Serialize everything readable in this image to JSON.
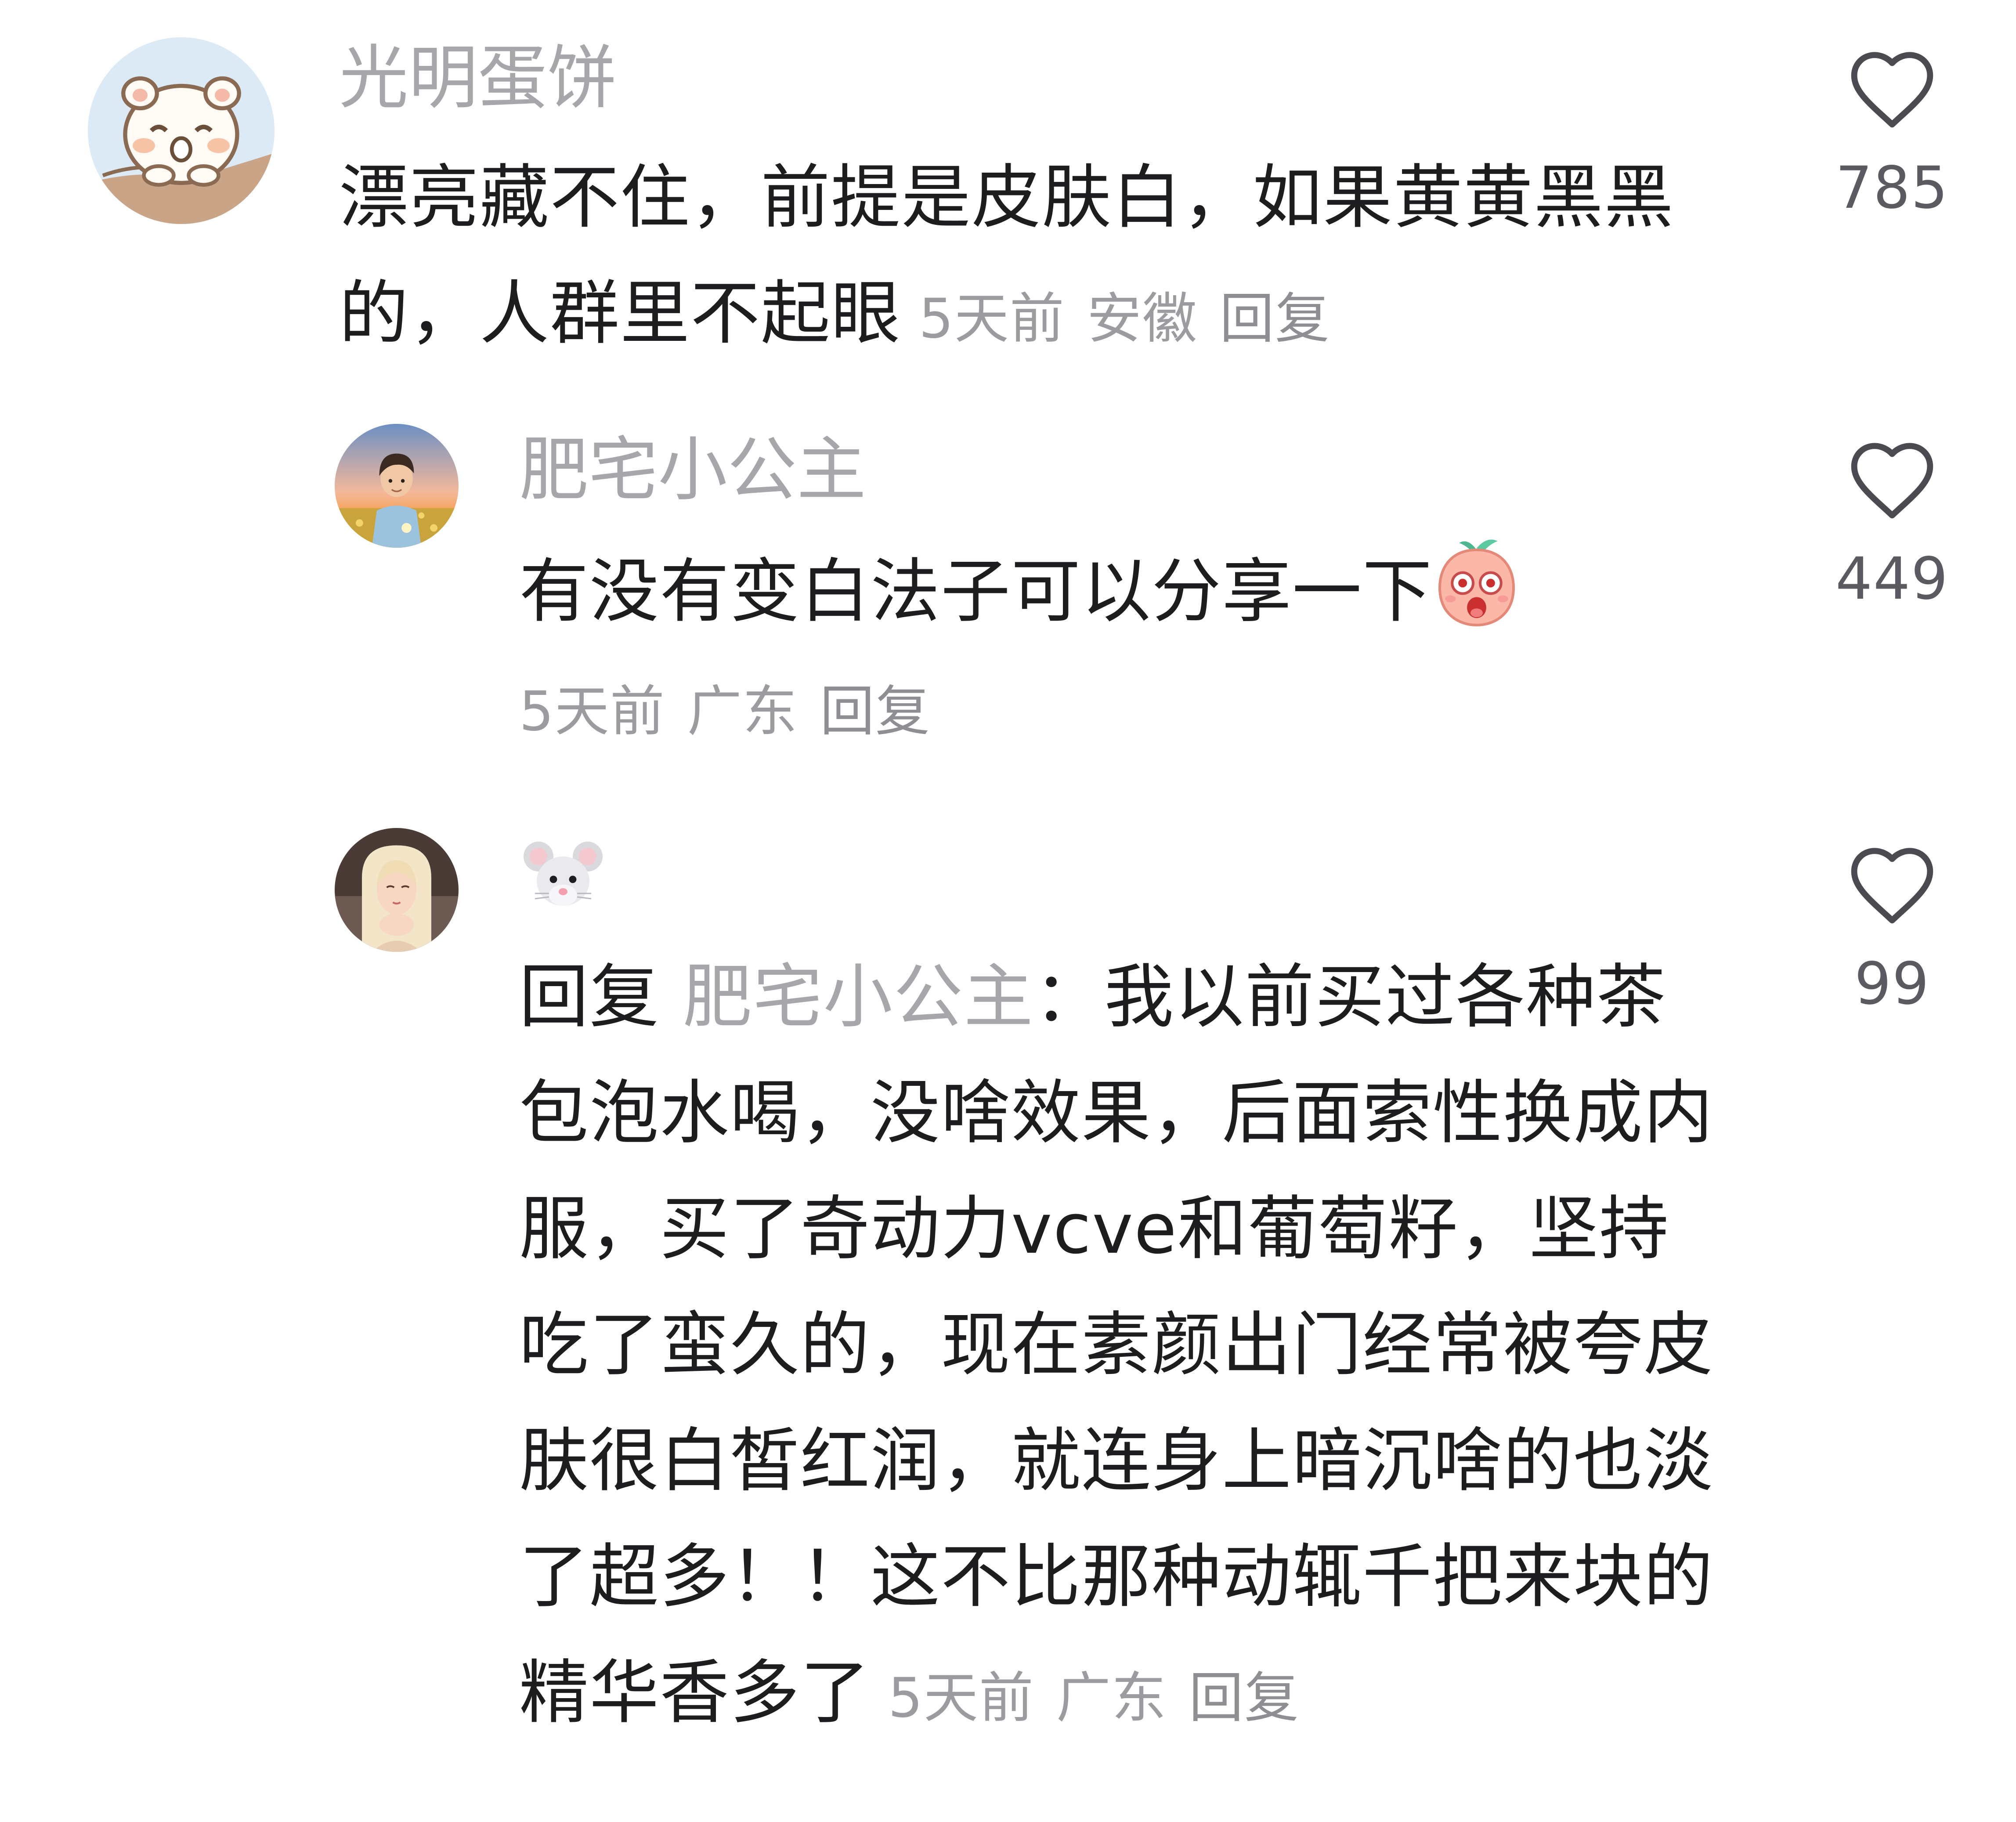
{
  "comments": [
    {
      "username": "光明蛋饼",
      "text": "漂亮藏不住，前提是皮肤白，如果黄黄黑黑的，人群里不起眼",
      "time": "5天前",
      "location": "安徽",
      "reply": "回复",
      "likes": "785",
      "avatar_icon": "cartoon-hamster-avatar"
    },
    {
      "username": "肥宅小公主",
      "text": "有没有变白法子可以分享一下",
      "emoji": "shocked-peach-emoji",
      "time": "5天前",
      "location": "广东",
      "reply": "回复",
      "likes": "449",
      "avatar_icon": "boy-sunset-avatar"
    },
    {
      "username_emoji": "mouse-face-emoji",
      "reply_prefix": "回复",
      "reply_to": "肥宅小公主",
      "colon": "：",
      "text": "我以前买过各种茶包泡水喝，没啥效果，后面索性换成内服，买了奇动力vcve和葡萄籽，坚持吃了蛮久的，现在素颜出门经常被夸皮肤很白皙红润，就连身上暗沉啥的也淡了超多！！这不比那种动辄千把来块的精华香多了",
      "time": "5天前",
      "location": "广东",
      "reply": "回复",
      "likes": "99",
      "avatar_icon": "girl-portrait-avatar"
    }
  ],
  "colors": {
    "username": "#a6a6ab",
    "text": "#1d1d1f",
    "meta": "#9b9ba0",
    "heart_stroke": "#4a4a50"
  }
}
